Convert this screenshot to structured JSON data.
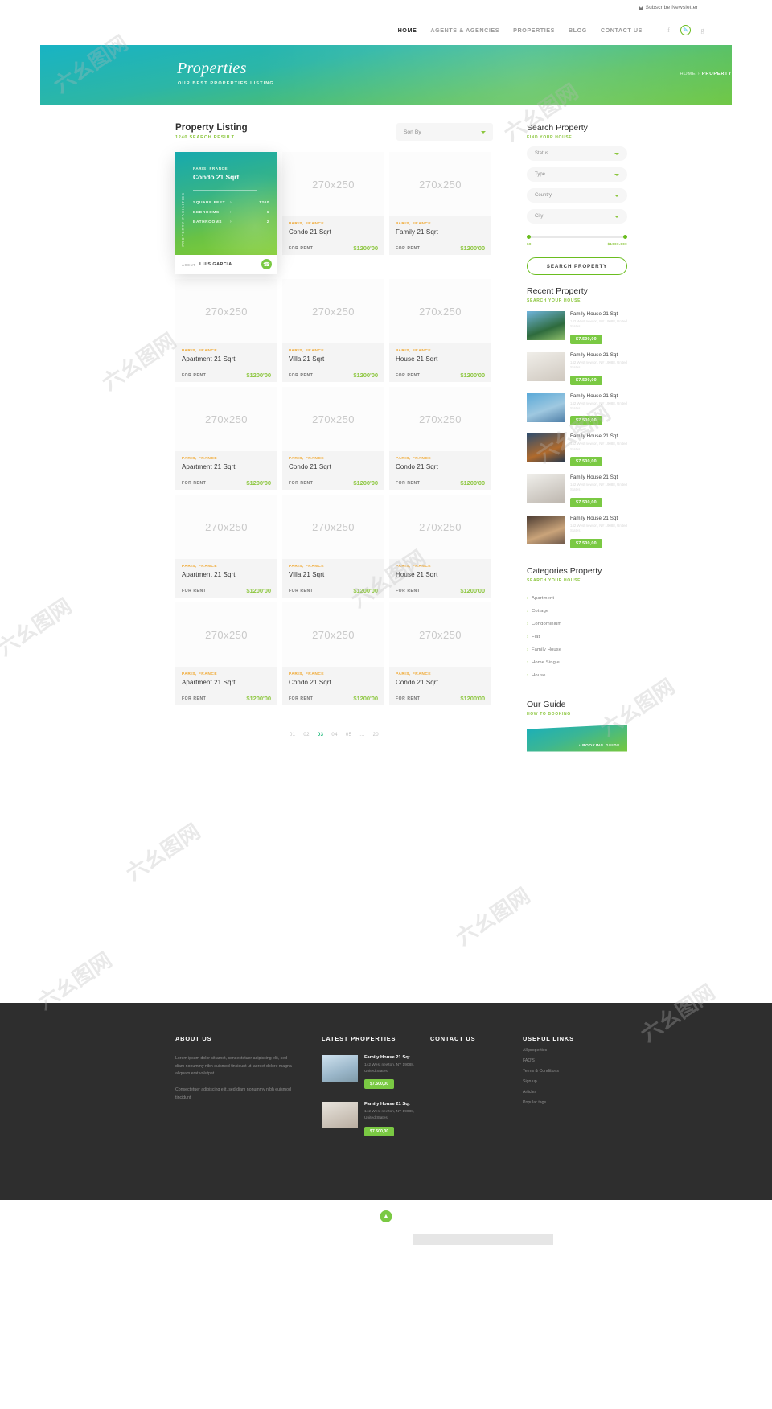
{
  "topbar": {
    "newsletter": "Subscribe Newsletter",
    "icon": "envelope-icon"
  },
  "nav": {
    "items": [
      {
        "label": "HOME",
        "active": true
      },
      {
        "label": "AGENTS & AGENCIES",
        "active": false
      },
      {
        "label": "PROPERTIES",
        "active": false
      },
      {
        "label": "BLOG",
        "active": false
      },
      {
        "label": "CONTACT US",
        "active": false
      }
    ],
    "socials": [
      {
        "name": "facebook-icon",
        "glyph": "f"
      },
      {
        "name": "twitter-icon",
        "glyph": "ᴠ"
      },
      {
        "name": "google-plus-icon",
        "glyph": "g"
      }
    ]
  },
  "hero": {
    "title": "Properties",
    "subtitle": "OUR BEST PROPERTIES LISTING",
    "breadcrumb_home": "HOME",
    "breadcrumb_sep": "›",
    "breadcrumb_current": "PROPERTY"
  },
  "listing": {
    "title": "Property Listing",
    "subtitle": "1240 SEARCH RESULT",
    "sort_label": "Sort By",
    "placeholder_text": "270x250",
    "for_rent_label": "FOR RENT",
    "featured": {
      "location": "PARIS, FRANCE",
      "name": "Condo 21 Sqrt",
      "vertical_label": "PROPERTY FACILITIES",
      "facilities": [
        {
          "label": "SQUARE FEET",
          "value": "1200"
        },
        {
          "label": "BEDROOMS",
          "value": "6"
        },
        {
          "label": "BATHROOMS",
          "value": "2"
        }
      ],
      "agent_label": "AGENT",
      "agent_name": "LUIS GARCIA",
      "phone_icon": "phone-icon"
    },
    "cards": [
      {
        "location": "PARIS, FRANCE",
        "name": "Condo 21 Sqrt",
        "price": "$1200'00"
      },
      {
        "location": "PARIS, FRANCE",
        "name": "Family 21 Sqrt",
        "price": "$1200'00"
      },
      {
        "location": "PARIS, FRANCE",
        "name": "Apartment 21 Sqrt",
        "price": "$1200'00"
      },
      {
        "location": "PARIS, FRANCE",
        "name": "Villa 21 Sqrt",
        "price": "$1200'00"
      },
      {
        "location": "PARIS, FRANCE",
        "name": "House 21 Sqrt",
        "price": "$1200'00"
      },
      {
        "location": "PARIS, FRANCE",
        "name": "Apartment 21 Sqrt",
        "price": "$1200'00"
      },
      {
        "location": "PARIS, FRANCE",
        "name": "Condo 21 Sqrt",
        "price": "$1200'00"
      },
      {
        "location": "PARIS, FRANCE",
        "name": "Condo 21 Sqrt",
        "price": "$1200'00"
      },
      {
        "location": "PARIS, FRANCE",
        "name": "Apartment 21 Sqrt",
        "price": "$1200'00"
      },
      {
        "location": "PARIS, FRANCE",
        "name": "Villa 21 Sqrt",
        "price": "$1200'00"
      },
      {
        "location": "PARIS, FRANCE",
        "name": "House 21 Sqrt",
        "price": "$1200'00"
      },
      {
        "location": "PARIS, FRANCE",
        "name": "Apartment 21 Sqrt",
        "price": "$1200'00"
      },
      {
        "location": "PARIS, FRANCE",
        "name": "Condo 21 Sqrt",
        "price": "$1200'00"
      },
      {
        "location": "PARIS, FRANCE",
        "name": "Condo 21 Sqrt",
        "price": "$1200'00"
      }
    ],
    "pagination": [
      {
        "label": "01",
        "active": false
      },
      {
        "label": "02",
        "active": false
      },
      {
        "label": "03",
        "active": true
      },
      {
        "label": "04",
        "active": false
      },
      {
        "label": "05",
        "active": false
      },
      {
        "label": "...",
        "active": false
      },
      {
        "label": "20",
        "active": false
      }
    ]
  },
  "sidebar": {
    "search": {
      "title": "Search Property",
      "subtitle": "FIND YOUR HOUSE",
      "fields": [
        "Status",
        "Type",
        "Country",
        "City"
      ],
      "price_min": "$0",
      "price_max": "$1000.000",
      "button": "SEARCH PROPERTY"
    },
    "recent": {
      "title": "Recent Property",
      "subtitle": "SEARCH YOUR HOUSE",
      "items": [
        {
          "name": "Family House 21 Sqt",
          "address": "142 West newton, NY\n19088, United States",
          "price": "$7.500,00"
        },
        {
          "name": "Family House 21 Sqt",
          "address": "142 West newton, NY\n19088, United States",
          "price": "$7.500,00"
        },
        {
          "name": "Family House 21 Sqt",
          "address": "142 West newton, NY\n19088, United States",
          "price": "$7.500,00"
        },
        {
          "name": "Family House 21 Sqt",
          "address": "142 West newton, NY\n19088, United States",
          "price": "$7.500,00"
        },
        {
          "name": "Family House 21 Sqt",
          "address": "142 West newton, NY\n19088, United States",
          "price": "$7.500,00"
        },
        {
          "name": "Family House 21 Sqt",
          "address": "142 West newton, NY\n19088, United States",
          "price": "$7.500,00"
        }
      ]
    },
    "categories": {
      "title": "Categories Property",
      "subtitle": "SEARCH YOUR HOUSE",
      "items": [
        "Apartment",
        "Cottage",
        "Condominium",
        "Flat",
        "Family House",
        "Home Single",
        "House"
      ]
    },
    "guide": {
      "title": "Our Guide",
      "subtitle": "HOW TO BOOKING",
      "banner_text": "› BOOKING GUIDE"
    }
  },
  "footer": {
    "about": {
      "heading": "ABOUT US",
      "p1": "Lorem ipsum dolor sit amet, consectetuer adipiscing elit, sed diam nonummy nibh euismod tincidunt ut laoreet dolore magna aliquam erat volutpat.",
      "p2": "Consectetuer adipiscing elit, sed diam nonummy nibh euismod tincidunt"
    },
    "latest": {
      "heading": "LATEST PROPERTIES",
      "items": [
        {
          "name": "Family House 21 Sqt",
          "address": "142 West newton, NY\n19088, United States",
          "price": "$7.500,00"
        },
        {
          "name": "Family House 21 Sqt",
          "address": "142 West newton, NY\n19088, United States",
          "price": "$7.500,00"
        }
      ]
    },
    "contact": {
      "heading": "CONTACT US"
    },
    "useful": {
      "heading": "USEFUL LINKS",
      "links": [
        "All properties",
        "FAQ'S",
        "Terms & Conditions",
        "Sign up",
        "Articles",
        "Popular tags"
      ]
    },
    "to_top_icon": "chevron-up-icon"
  },
  "colors": {
    "accent_green": "#8cc63e",
    "badge_green": "#7ac943",
    "teal": "#16a9ae",
    "orange": "#f0a72e",
    "footer_bg": "#2e2e2e"
  }
}
